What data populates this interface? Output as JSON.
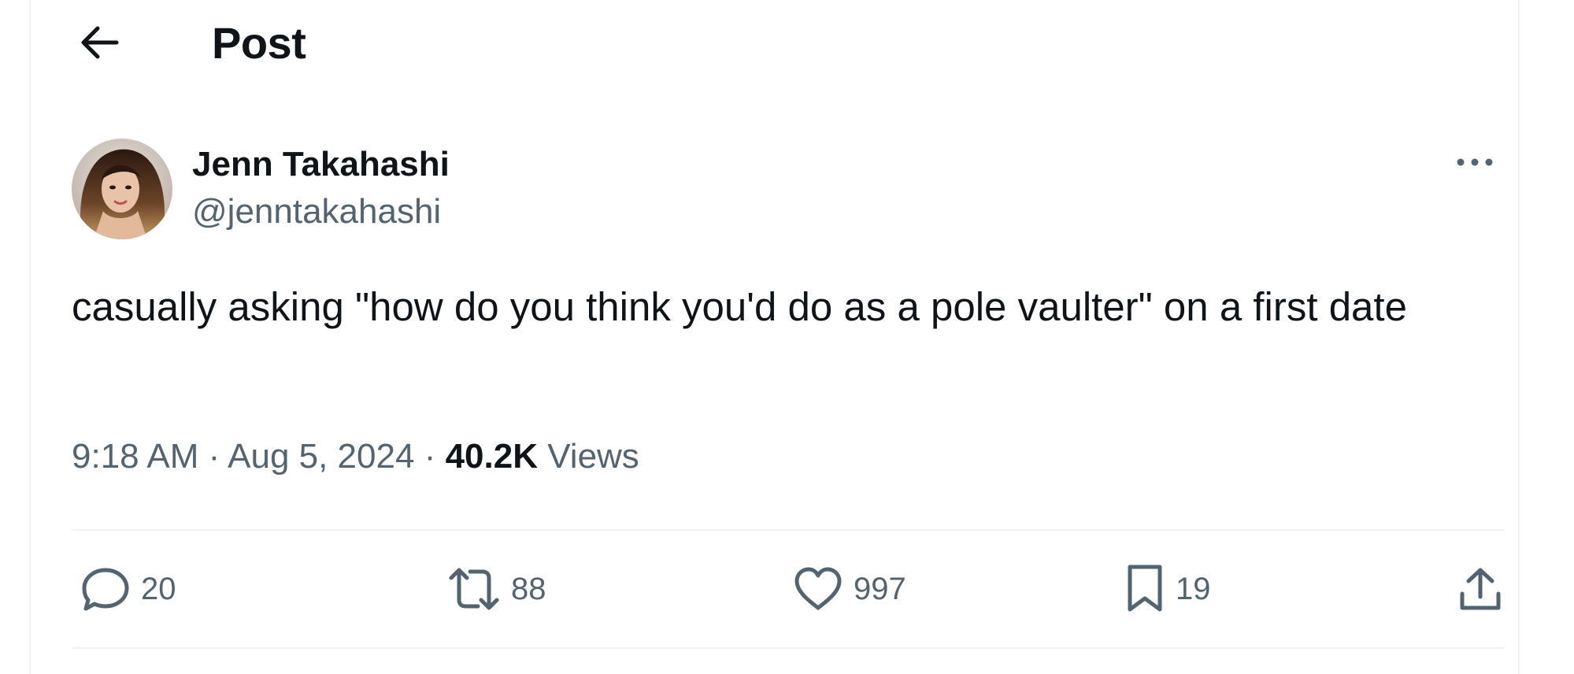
{
  "header": {
    "title": "Post",
    "back_icon": "arrow-left-icon"
  },
  "author": {
    "name": "Jenn Takahashi",
    "handle": "@jenntakahashi",
    "more_icon": "more-horizontal-icon"
  },
  "tweet": {
    "text": "casually asking \"how do you think you'd do as a pole vaulter\" on a first date"
  },
  "meta": {
    "time": "9:18 AM",
    "separator": "·",
    "date": "Aug 5, 2024",
    "views_count": "40.2K",
    "views_label": "Views"
  },
  "actions": {
    "replies": "20",
    "reposts": "88",
    "likes": "997",
    "bookmarks": "19"
  },
  "colors": {
    "text": "#0f1419",
    "secondary": "#536471",
    "border": "#eff3f4"
  }
}
